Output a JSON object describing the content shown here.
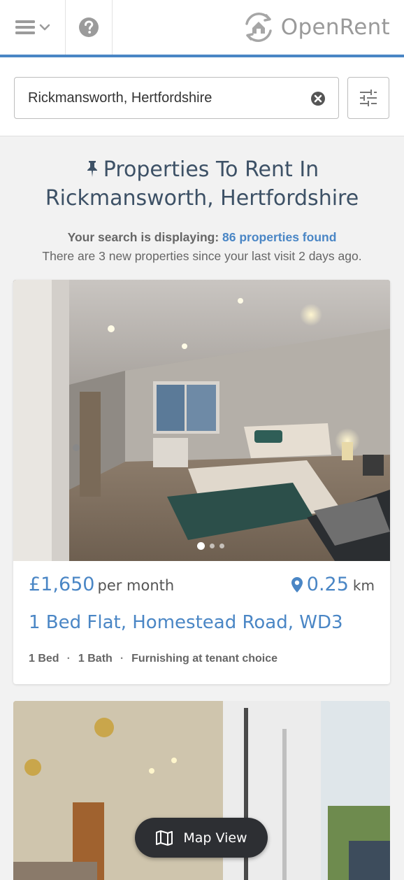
{
  "header": {
    "menu_icon": "hamburger-icon",
    "menu_chevron_icon": "chevron-down-icon",
    "help_icon": "question-circle-icon",
    "logo_text": "OpenRent",
    "logo_icon": "house-refresh-icon",
    "accent_color": "#4a86c5"
  },
  "search": {
    "value": "Rickmansworth, Hertfordshire",
    "clear_icon": "close-circle-icon",
    "filter_icon": "sliders-icon"
  },
  "results": {
    "title_line1": "Properties To Rent In",
    "title_line2": "Rickmansworth, Hertfordshire",
    "title_icon": "pin-icon",
    "summary_label": "Your search is displaying:",
    "summary_count": "86 properties found",
    "new_since": "There are 3 new properties since your last visit 2 days ago."
  },
  "listings": [
    {
      "price": "£1,650",
      "price_period": "per month",
      "distance_value": "0.25",
      "distance_unit": "km",
      "title": "1 Bed Flat, Homestead Road, WD3",
      "features": [
        "1 Bed",
        "1 Bath",
        "Furnishing at tenant choice"
      ],
      "photo_count": 3,
      "active_photo": 1
    },
    {
      "photo": "living-room-balcony"
    }
  ],
  "map_button": {
    "label": "Map View",
    "icon": "map-icon"
  }
}
